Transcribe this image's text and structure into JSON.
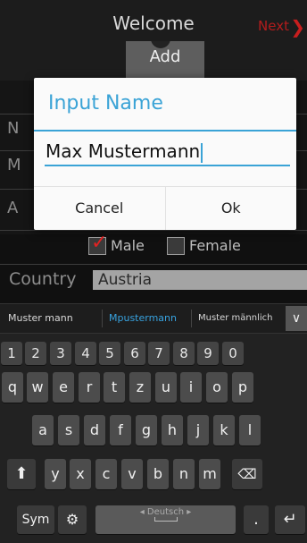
{
  "app": {
    "title": "Welcome",
    "next_label": "Next",
    "add_photo_label": "Add",
    "row_letters": [
      "N",
      "M",
      "A"
    ]
  },
  "dialog": {
    "title": "Input Name",
    "input_value": "Max Mustermann",
    "cancel_label": "Cancel",
    "ok_label": "Ok"
  },
  "gender": {
    "male_label": "Male",
    "male_checked": true,
    "female_label": "Female",
    "female_checked": false
  },
  "country": {
    "label": "Country",
    "value": "Austria"
  },
  "suggestions": {
    "items": [
      "Muster mann",
      "Mpustermann",
      "Muster männlich"
    ]
  },
  "keyboard": {
    "numbers": [
      "1",
      "2",
      "3",
      "4",
      "5",
      "6",
      "7",
      "8",
      "9",
      "0"
    ],
    "row1": [
      "q",
      "w",
      "e",
      "r",
      "t",
      "z",
      "u",
      "i",
      "o",
      "p"
    ],
    "row2": [
      "a",
      "s",
      "d",
      "f",
      "g",
      "h",
      "j",
      "k",
      "l"
    ],
    "row3": [
      "y",
      "x",
      "c",
      "v",
      "b",
      "n",
      "m"
    ],
    "sym_label": "Sym",
    "language_label": "Deutsch",
    "dot_label": "."
  },
  "colors": {
    "accent": "#3aa3d6",
    "next": "#b31c1c",
    "checkmark": "#e02222"
  }
}
